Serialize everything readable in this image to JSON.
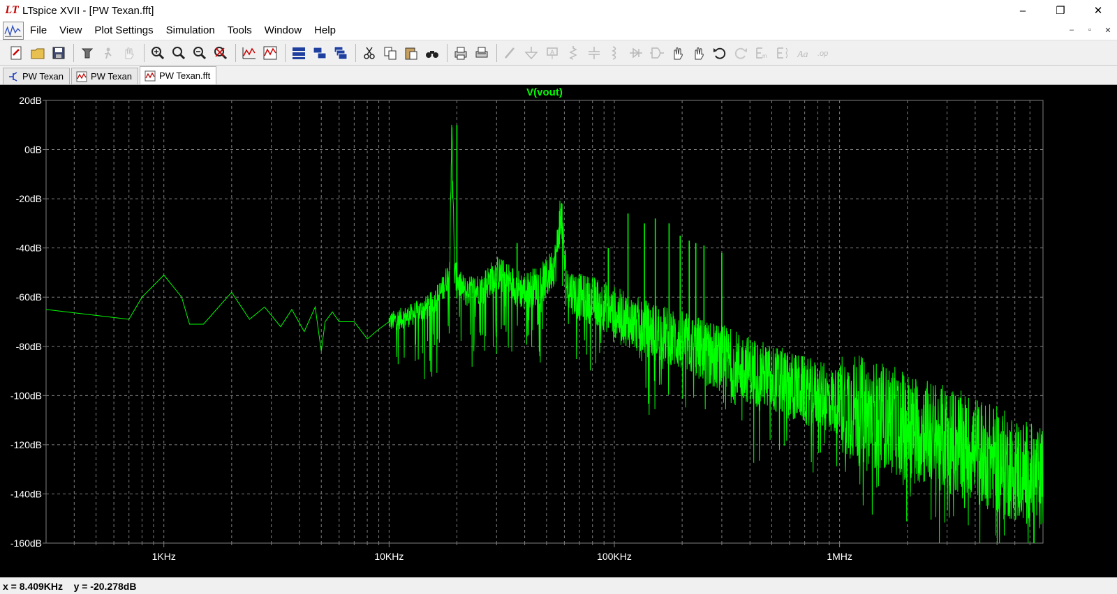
{
  "window": {
    "title": "LTspice XVII - [PW Texan.fft]",
    "controls": [
      "–",
      "❐",
      "✕"
    ]
  },
  "menu": {
    "items": [
      "File",
      "View",
      "Plot Settings",
      "Simulation",
      "Tools",
      "Window",
      "Help"
    ],
    "mdi_controls": [
      "–",
      "▫",
      "✕"
    ]
  },
  "toolbar": {
    "buttons": [
      {
        "icon": "new-schematic-icon"
      },
      {
        "icon": "open-folder-icon"
      },
      {
        "icon": "save-icon"
      },
      {
        "icon": "control-panel-icon"
      },
      {
        "icon": "run-icon"
      },
      {
        "icon": "halt-icon"
      },
      {
        "icon": "zoom-in-icon"
      },
      {
        "icon": "zoom-pan-icon"
      },
      {
        "icon": "zoom-out-icon"
      },
      {
        "icon": "zoom-fit-icon"
      },
      {
        "icon": "autorange-icon"
      },
      {
        "icon": "waveform-icon"
      },
      {
        "icon": "tile-horizontal-icon"
      },
      {
        "icon": "tile-vertical-icon"
      },
      {
        "icon": "cascade-icon"
      },
      {
        "icon": "cut-icon"
      },
      {
        "icon": "copy-icon"
      },
      {
        "icon": "paste-icon"
      },
      {
        "icon": "find-icon"
      },
      {
        "icon": "print-icon"
      },
      {
        "icon": "print-preview-icon"
      },
      {
        "icon": "wire-icon"
      },
      {
        "icon": "ground-icon"
      },
      {
        "icon": "label-icon"
      },
      {
        "icon": "resistor-icon"
      },
      {
        "icon": "capacitor-icon"
      },
      {
        "icon": "inductor-icon"
      },
      {
        "icon": "diode-icon"
      },
      {
        "icon": "component-icon"
      },
      {
        "icon": "move-icon"
      },
      {
        "icon": "drag-icon"
      },
      {
        "icon": "undo-icon"
      },
      {
        "icon": "redo-icon"
      },
      {
        "icon": "rotate-icon"
      },
      {
        "icon": "mirror-icon"
      },
      {
        "icon": "text-icon"
      },
      {
        "icon": "spice-directive-icon"
      }
    ]
  },
  "tabs": [
    {
      "label": "PW Texan",
      "icon": "schematic-icon",
      "active": false
    },
    {
      "label": "PW Texan",
      "icon": "waveform-icon",
      "active": false
    },
    {
      "label": "PW Texan.fft",
      "icon": "waveform-icon",
      "active": true
    }
  ],
  "plot": {
    "trace_label": "V(vout)",
    "trace_color": "#00ff00",
    "background": "#000000",
    "axis_color": "#808080",
    "grid_color": "#808080"
  },
  "chart_data": {
    "type": "line",
    "title": "V(vout)",
    "x_scale": "log",
    "xlim": [
      300,
      8000000
    ],
    "ylim": [
      -160,
      20
    ],
    "x_tick_labels": [
      "1KHz",
      "10KHz",
      "100KHz",
      "1MHz"
    ],
    "x_tick_values": [
      1000,
      10000,
      100000,
      1000000
    ],
    "y_tick_labels": [
      "20dB",
      "0dB",
      "-20dB",
      "-40dB",
      "-60dB",
      "-80dB",
      "-100dB",
      "-120dB",
      "-140dB",
      "-160dB"
    ],
    "y_tick_values": [
      20,
      0,
      -20,
      -40,
      -60,
      -80,
      -100,
      -120,
      -140,
      -160
    ],
    "grid": true,
    "series": [
      {
        "name": "V(vout)",
        "x": [
          300,
          700,
          800,
          1000,
          1200,
          1300,
          1500,
          2000,
          2400,
          2800,
          3300,
          3700,
          4200,
          4700,
          5000,
          5200,
          5600,
          6000,
          7000,
          8000,
          9000,
          10000,
          12000,
          15000,
          17000,
          18500,
          19000,
          19500,
          20500,
          22000,
          26000,
          30000,
          40000,
          50000,
          55000,
          58000,
          60000,
          62000,
          70000,
          85000,
          100000,
          118000,
          150000,
          200000,
          300000,
          500000,
          1000000,
          2000000,
          4000000,
          8000000
        ],
        "y": [
          -65,
          -69,
          -60,
          -51,
          -60,
          -71,
          -71,
          -58,
          -69,
          -64,
          -72,
          -65,
          -74,
          -64,
          -82,
          -70,
          -66,
          -70,
          -70,
          -77,
          -73,
          -70,
          -68,
          -64,
          -58,
          -50,
          9,
          -50,
          -55,
          -58,
          -56,
          -50,
          -58,
          -53,
          -45,
          -24,
          -45,
          -56,
          -60,
          -62,
          -66,
          -70,
          -74,
          -78,
          -85,
          -93,
          -103,
          -112,
          -122,
          -135
        ],
        "peaks": [
          {
            "x": 19000,
            "y": 9
          },
          {
            "x": 20000,
            "y": 10
          },
          {
            "x": 37000,
            "y": -38
          },
          {
            "x": 58000,
            "y": -24
          },
          {
            "x": 94000,
            "y": -40
          },
          {
            "x": 115000,
            "y": -26
          },
          {
            "x": 136000,
            "y": -30
          },
          {
            "x": 152000,
            "y": -28
          },
          {
            "x": 175000,
            "y": -30
          },
          {
            "x": 196000,
            "y": -35
          },
          {
            "x": 215000,
            "y": -37
          },
          {
            "x": 230000,
            "y": -38
          },
          {
            "x": 250000,
            "y": -39
          },
          {
            "x": 300000,
            "y": -42
          }
        ]
      }
    ]
  },
  "status": {
    "x_readout": "x = 8.409KHz",
    "y_readout": "y = -20.278dB"
  }
}
